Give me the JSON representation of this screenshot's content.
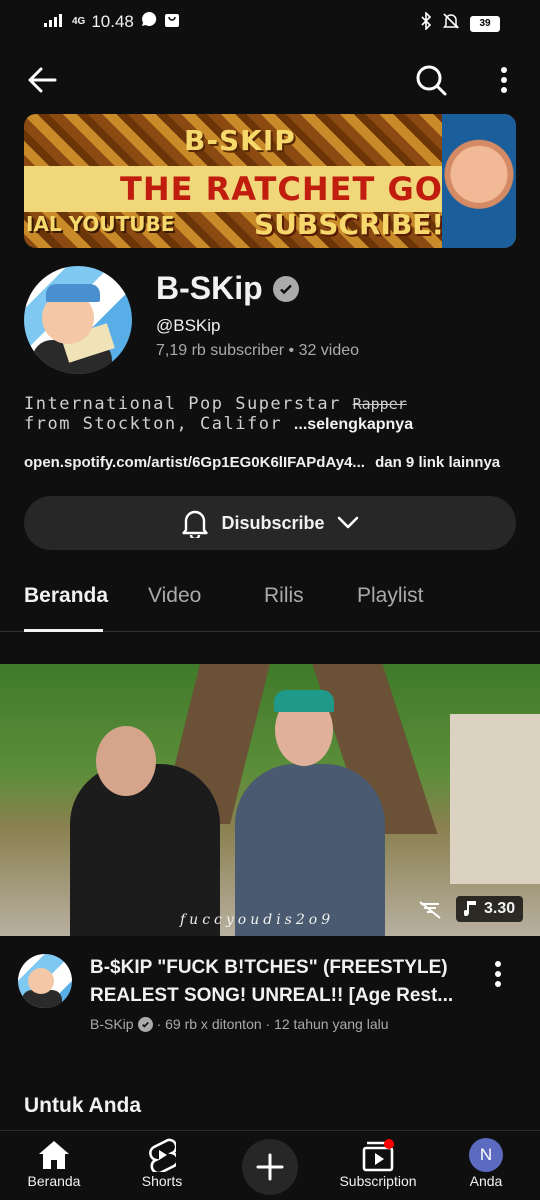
{
  "status_bar": {
    "network": "4G",
    "time": "10.48",
    "battery": "39"
  },
  "banner": {
    "line1": "B-SKIP",
    "line2": "THE RATCHET GOD",
    "line3": "IAL YOUTUBE",
    "line4": "SUBSCRIBE!"
  },
  "channel": {
    "name": "B-SKip",
    "handle": "@BSKip",
    "subscribers": "7,19 rb subscriber",
    "videos": "32 video",
    "description_line1": "International Pop Superstar",
    "description_rapper": "Rapper",
    "description_line2": "from Stockton, Califor",
    "description_more": "...selengkapnya",
    "link": "open.spotify.com/artist/6Gp1EG0K6lIFAPdAy4...",
    "more_links": "dan 9 link lainnya",
    "subscribe_label": "Disubscribe"
  },
  "tabs": [
    {
      "label": "Beranda"
    },
    {
      "label": "Video"
    },
    {
      "label": "Rilis"
    },
    {
      "label": "Playlist"
    }
  ],
  "video": {
    "watermark": "fuccyoudis2o9",
    "duration": "3.30",
    "title": "B-$KIP \"FUCK B!TCHES\" (FREESTYLE) REALEST SONG! UNREAL!! [Age Rest...",
    "channel": "B-SKip",
    "meta": "· 69 rb x ditonton · 12 tahun yang lalu"
  },
  "section": {
    "title": "Untuk Anda"
  },
  "bottom_nav": {
    "home": "Beranda",
    "shorts": "Shorts",
    "subscriptions": "Subscription",
    "you": "Anda",
    "you_initial": "N"
  },
  "colors": {
    "background": "#0f0f0f",
    "surface": "#272727",
    "text_primary": "#f1f1f1",
    "text_secondary": "#aaaaaa",
    "notification": "#ff0000",
    "avatar_you": "#5c6bc0"
  }
}
